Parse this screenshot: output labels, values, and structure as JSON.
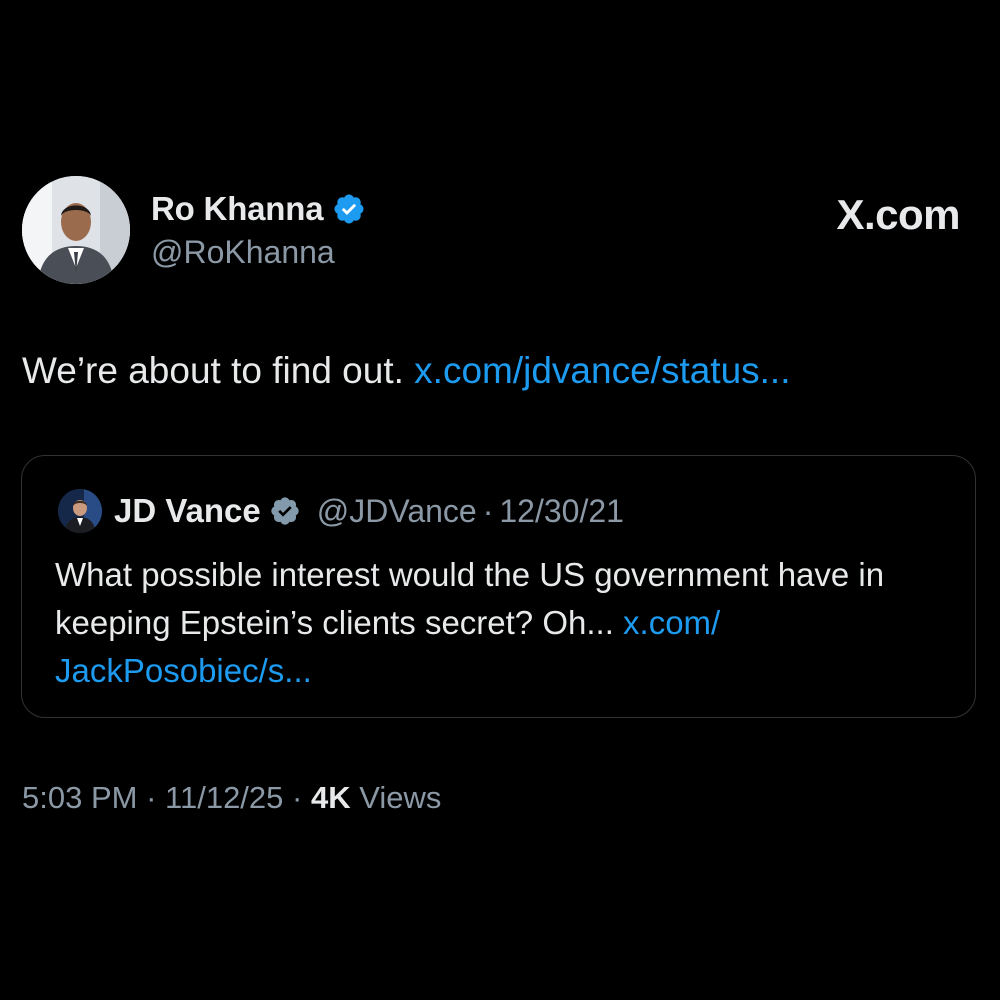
{
  "author": {
    "name": "Ro Khanna",
    "handle": "@RoKhanna",
    "verified": true,
    "avatar": "profile-photo"
  },
  "brand": {
    "wordmark": "X.com"
  },
  "tweet": {
    "text": "We’re about to find out. ",
    "link": "x.com/jdvance/status..."
  },
  "quote": {
    "name": "JD Vance",
    "handle": "@JDVance",
    "separator": "·",
    "date": "12/30/21",
    "verified": true,
    "text": "What possible interest would the US government have in keeping Epstein’s clients secret? Oh... ",
    "link_line1": "x.com/",
    "link_line2": "JackPosobiec/s..."
  },
  "meta": {
    "time": "5:03 PM",
    "separator": "·",
    "date": "11/12/25",
    "views_count": "4K",
    "views_label": "Views"
  },
  "colors": {
    "background": "#000000",
    "text": "#e7e9ea",
    "secondary_text": "#8b98a5",
    "link": "#1d9bf0",
    "verified_badge": "#1d9bf0",
    "card_border": "#2f3336"
  }
}
